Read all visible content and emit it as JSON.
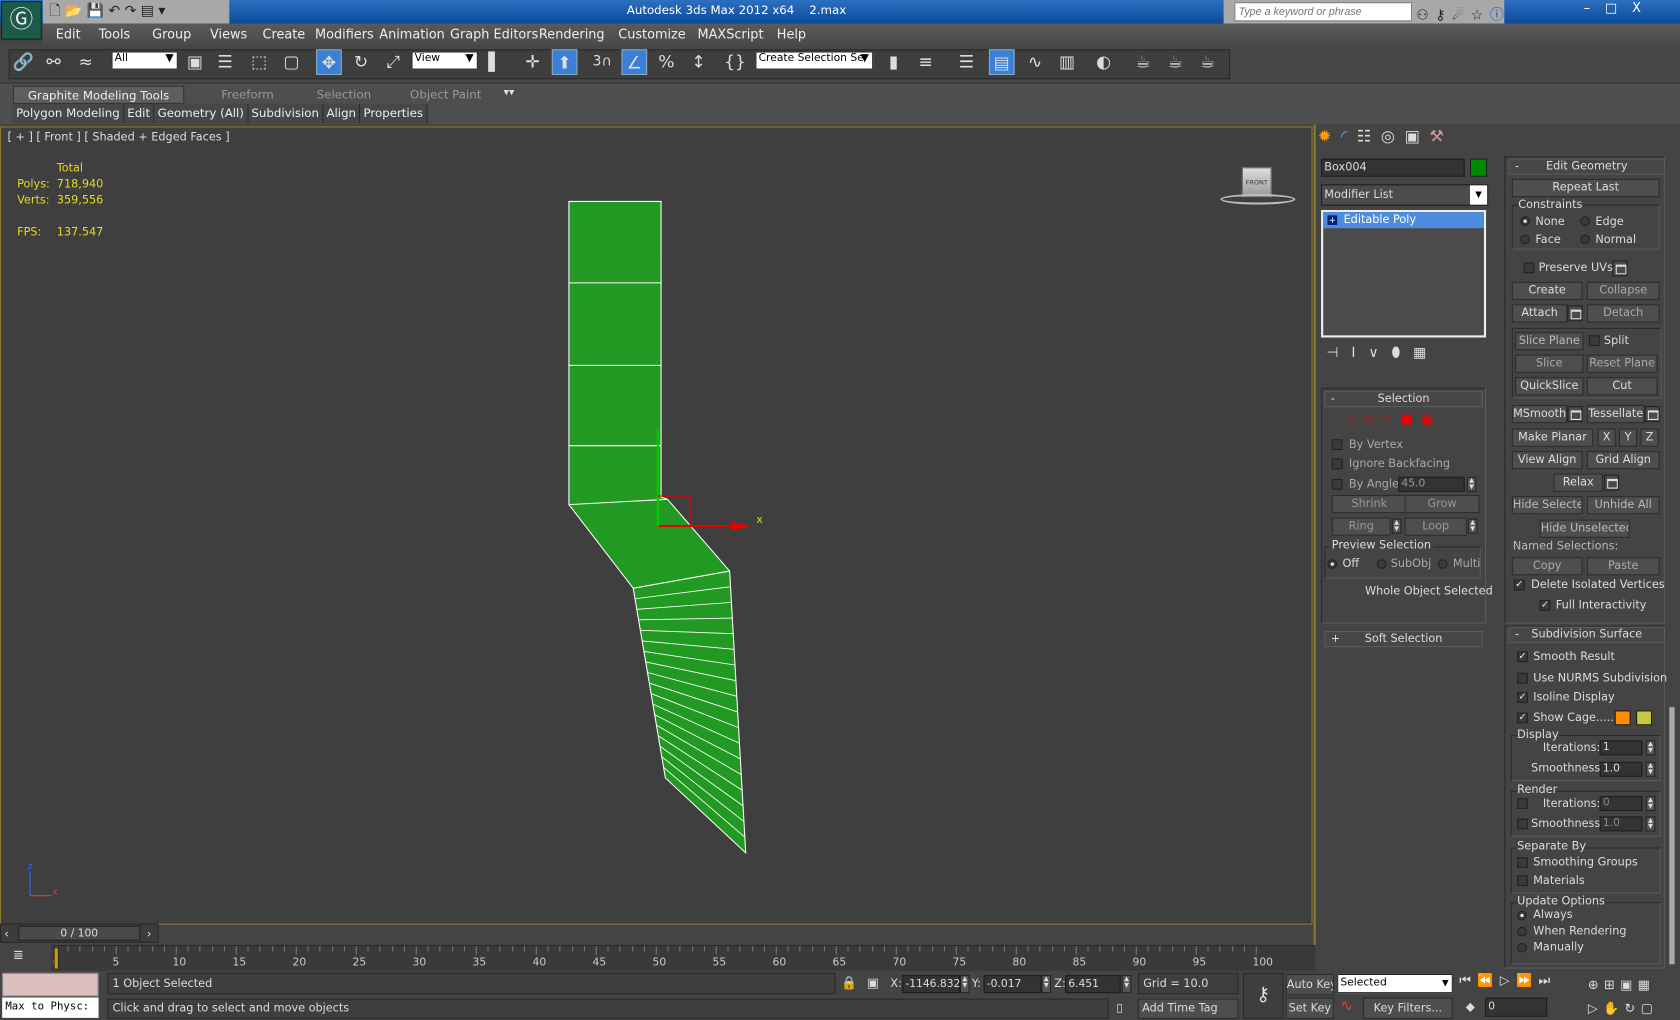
{
  "title_bar": {
    "app_title": "Autodesk 3ds Max  2012 x64",
    "file_name": "2.max",
    "search_placeholder": "Type a keyword or phrase"
  },
  "menu": [
    "Edit",
    "Tools",
    "Group",
    "Views",
    "Create",
    "Modifiers",
    "Animation",
    "Graph Editors",
    "Rendering",
    "Customize",
    "MAXScript",
    "Help"
  ],
  "toolbar": {
    "selection_filter": "All",
    "ref_coord": "View",
    "named_selection": "Create Selection Se",
    "snap_label": "3"
  },
  "ribbon": {
    "tabs": [
      "Graphite Modeling Tools",
      "Freeform",
      "Selection",
      "Object Paint"
    ],
    "panels": [
      "Polygon Modeling",
      "Edit",
      "Geometry (All)",
      "Subdivision",
      "Align",
      "Properties"
    ]
  },
  "viewport": {
    "label": "[ + ] [ Front ] [ Shaded + Edged Faces ]",
    "stats": {
      "header": "Total",
      "polys_label": "Polys:",
      "polys": "718,940",
      "verts_label": "Verts:",
      "verts": "359,556",
      "fps_label": "FPS:",
      "fps": "137.547"
    },
    "viewcube_label": "FRONT",
    "gizmo_x": "x",
    "axis_z": "z",
    "axis_x": "x",
    "mesh_color": "#229922"
  },
  "command_panel": {
    "object_name": "Box004",
    "object_color": "#008a00",
    "modifier_list": "Modifier List",
    "stack": [
      "Editable Poly"
    ],
    "selection": {
      "title": "Selection",
      "by_vertex": "By Vertex",
      "ignore_backfacing": "Ignore Backfacing",
      "by_angle": "By Angle:",
      "angle": "45.0",
      "shrink": "Shrink",
      "grow": "Grow",
      "ring": "Ring",
      "loop": "Loop",
      "preview": "Preview Selection",
      "off": "Off",
      "subobj": "SubObj",
      "multi": "Multi",
      "status": "Whole Object Selected"
    },
    "soft_selection": "Soft Selection",
    "edit_geometry": {
      "title": "Edit Geometry",
      "repeat_last": "Repeat Last",
      "constraints": "Constraints",
      "none": "None",
      "edge": "Edge",
      "face": "Face",
      "normal": "Normal",
      "preserve_uvs": "Preserve UVs",
      "create": "Create",
      "collapse": "Collapse",
      "attach": "Attach",
      "detach": "Detach",
      "slice_plane": "Slice Plane",
      "split": "Split",
      "slice": "Slice",
      "reset_plane": "Reset Plane",
      "quickslice": "QuickSlice",
      "cut": "Cut",
      "msmooth": "MSmooth",
      "tessellate": "Tessellate",
      "make_planar": "Make Planar",
      "x": "X",
      "y": "Y",
      "z": "Z",
      "view_align": "View Align",
      "grid_align": "Grid Align",
      "relax": "Relax",
      "hide_selected": "Hide Selected",
      "unhide_all": "Unhide All",
      "hide_unselected": "Hide Unselected",
      "named_selections": "Named Selections:",
      "copy": "Copy",
      "paste": "Paste",
      "delete_isolated": "Delete Isolated Vertices",
      "full_interactivity": "Full Interactivity"
    },
    "subdivision": {
      "title": "Subdivision Surface",
      "smooth_result": "Smooth Result",
      "use_nurms": "Use NURMS Subdivision",
      "isoline": "Isoline Display",
      "show_cage": "Show Cage......",
      "cage_color1": "#ff8c00",
      "cage_color2": "#c8c840",
      "display": "Display",
      "iterations": "Iterations:",
      "display_iterations": "1",
      "smoothness": "Smoothness:",
      "display_smoothness": "1.0",
      "render": "Render",
      "render_iterations": "0",
      "render_smoothness": "1.0",
      "separate_by": "Separate By",
      "smoothing_groups": "Smoothing Groups",
      "materials": "Materials",
      "update_options": "Update Options",
      "always": "Always",
      "when_rendering": "When Rendering",
      "manually": "Manually"
    }
  },
  "timeline": {
    "frame": "0 / 100",
    "labels": [
      "0",
      "5",
      "10",
      "15",
      "20",
      "25",
      "30",
      "35",
      "40",
      "45",
      "50",
      "55",
      "60",
      "65",
      "70",
      "75",
      "80",
      "85",
      "90",
      "95",
      "100"
    ]
  },
  "status": {
    "maxscript": "Max to Physc:",
    "selected": "1 Object Selected",
    "prompt": "Click and drag to select and move objects",
    "x_label": "X:",
    "x": "-1146.832",
    "y_label": "Y:",
    "y": "-0.017",
    "z_label": "Z:",
    "z": "6.451",
    "grid": "Grid = 10.0",
    "add_time_tag": "Add Time Tag",
    "auto_key": "Auto Key",
    "set_key": "Set Key",
    "key_mode": "Selected",
    "key_filters": "Key Filters...",
    "current_frame": "0"
  }
}
